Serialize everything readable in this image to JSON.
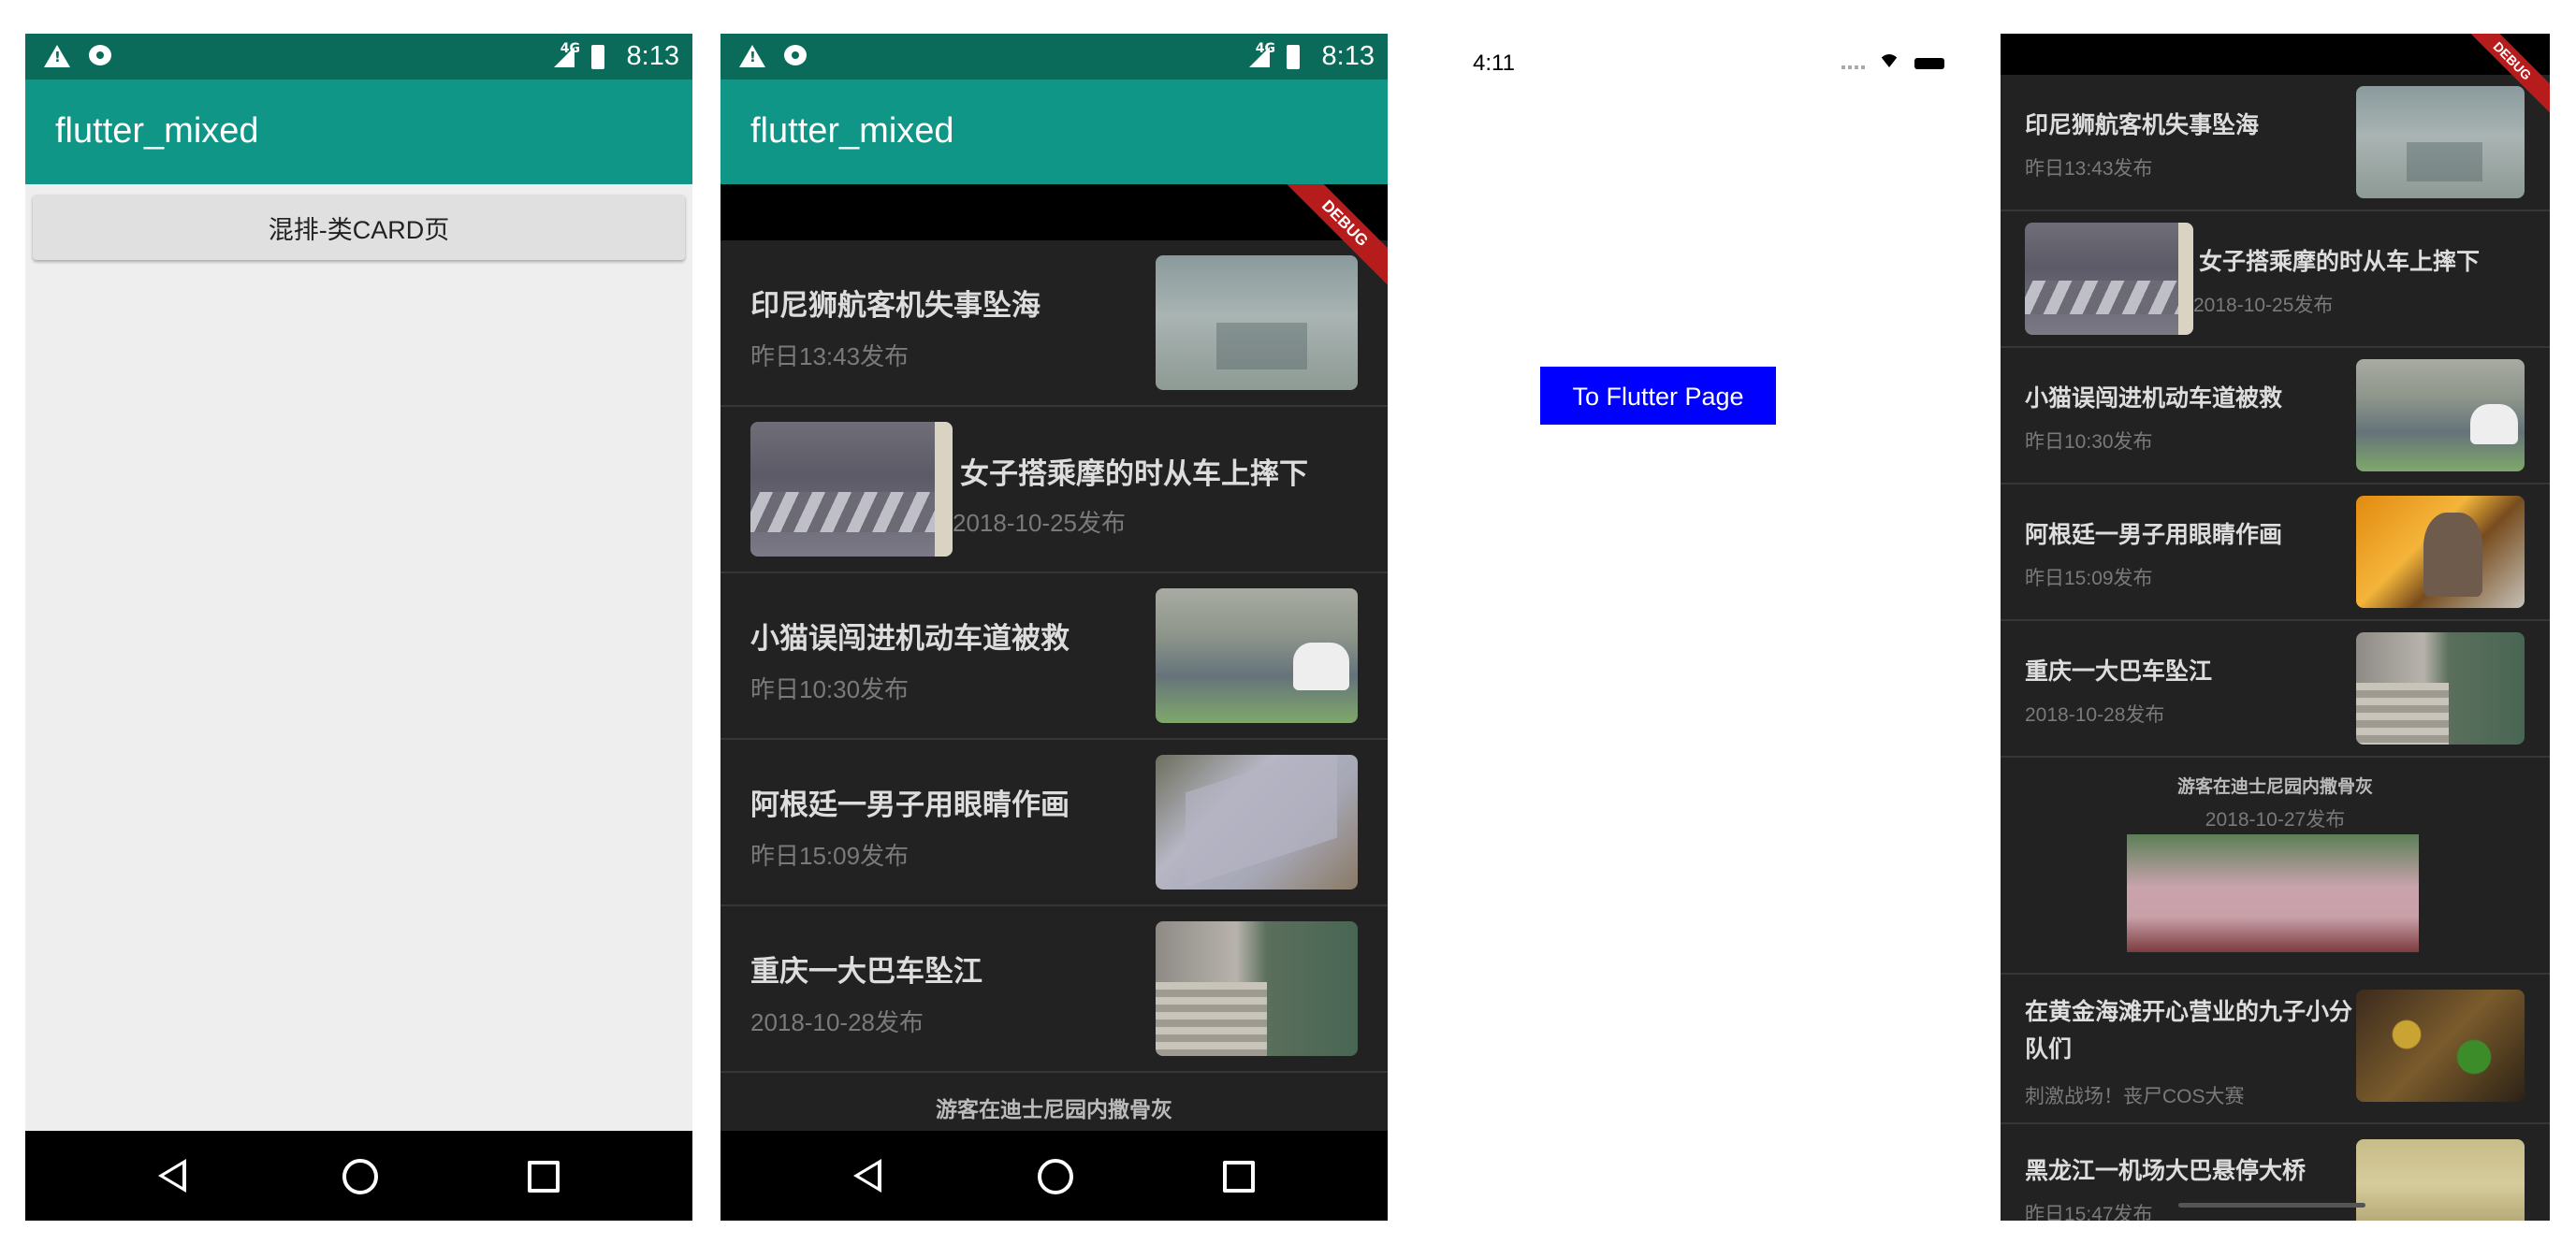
{
  "screens": {
    "android_home": {
      "status_time": "8:13",
      "status_network": "4G",
      "app_title": "flutter_mixed",
      "button_label": "混排-类CARD页"
    },
    "android_list": {
      "status_time": "8:13",
      "status_network": "4G",
      "app_title": "flutter_mixed",
      "debug_banner": "DEBUG",
      "items": [
        {
          "title": "印尼狮航客机失事坠海",
          "date": "昨日13:43发布",
          "thumb_icon": "water-thumbnail"
        },
        {
          "title": "女子搭乘摩的时从车上摔下",
          "date": "2018-10-25发布",
          "thumb_icon": "crosswalk-thumbnail"
        },
        {
          "title": "小猫误闯进机动车道被救",
          "date": "昨日10:30发布",
          "thumb_icon": "road-thumbnail"
        },
        {
          "title": "阿根廷一男子用眼睛作画",
          "date": "昨日15:09发布",
          "thumb_icon": "painting-thumbnail"
        },
        {
          "title": "重庆一大巴车坠江",
          "date": "2018-10-28发布",
          "thumb_icon": "bus-river-thumbnail"
        }
      ],
      "partial_item": "游客在迪士尼园内撒骨灰"
    },
    "ios_native": {
      "status_time": "4:11",
      "button_label": "To Flutter Page"
    },
    "ios_list": {
      "debug_banner": "DEBUG",
      "items": [
        {
          "title": "印尼狮航客机失事坠海",
          "date": "昨日13:43发布"
        },
        {
          "title": "女子搭乘摩的时从车上摔下",
          "date": "2018-10-25发布"
        },
        {
          "title": "小猫误闯进机动车道被救",
          "date": "昨日10:30发布"
        },
        {
          "title": "阿根廷一男子用眼睛作画",
          "date": "昨日15:09发布"
        },
        {
          "title": "重庆一大巴车坠江",
          "date": "2018-10-28发布"
        }
      ],
      "card_item": {
        "title": "游客在迪士尼园内撒骨灰",
        "date": "2018-10-27发布"
      },
      "multi_item": {
        "title": "在黄金海滩开心营业的九子小分队们",
        "subtitle": "刺激战场！丧尸COS大赛"
      },
      "last_item": {
        "title": "黑龙江一机场大巴悬停大桥",
        "date": "昨日15:47发布"
      }
    }
  }
}
